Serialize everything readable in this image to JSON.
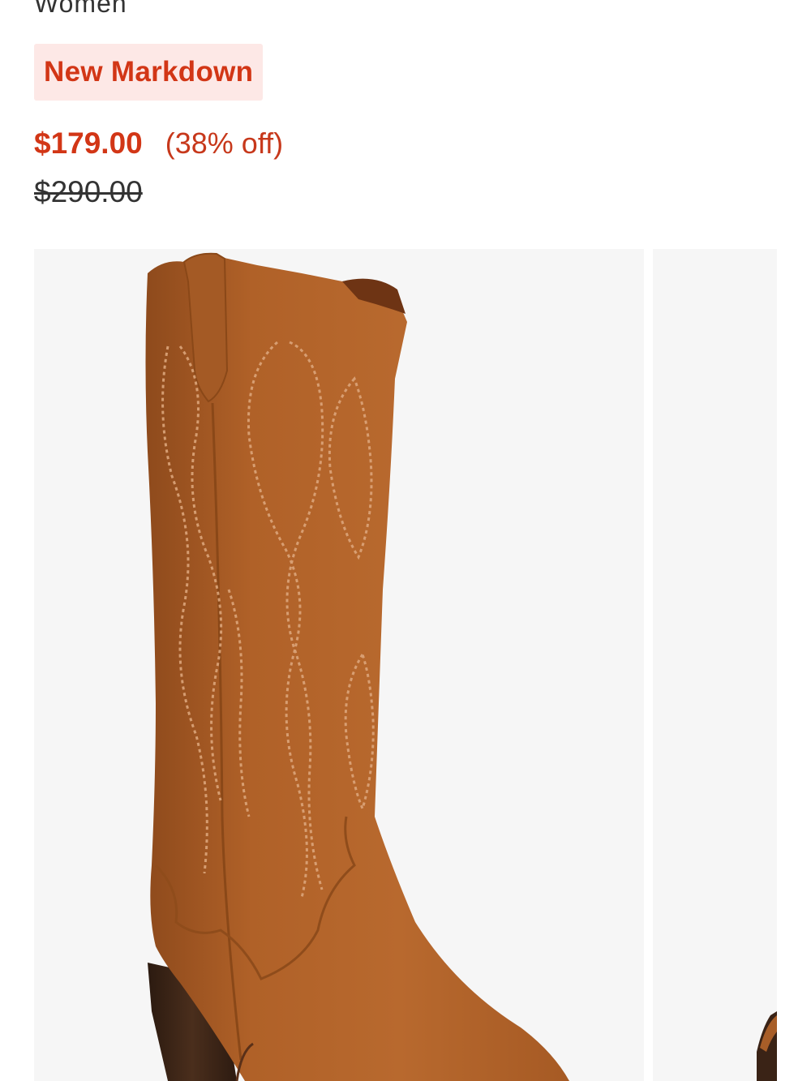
{
  "product": {
    "category": "Women",
    "badge": "New Markdown",
    "sale_price": "$179.00",
    "discount": "(38% off)",
    "original_price": "$290.00"
  },
  "gallery": {
    "images": [
      {
        "icon": "brown-suede-western-boot-image"
      },
      {
        "icon": "brown-suede-western-boot-image"
      }
    ]
  },
  "colors": {
    "sale_red": "#d23616",
    "badge_bg": "#fde8e6",
    "text_dark": "#333333",
    "image_bg": "#f6f6f6",
    "suede": "#b2662c"
  }
}
